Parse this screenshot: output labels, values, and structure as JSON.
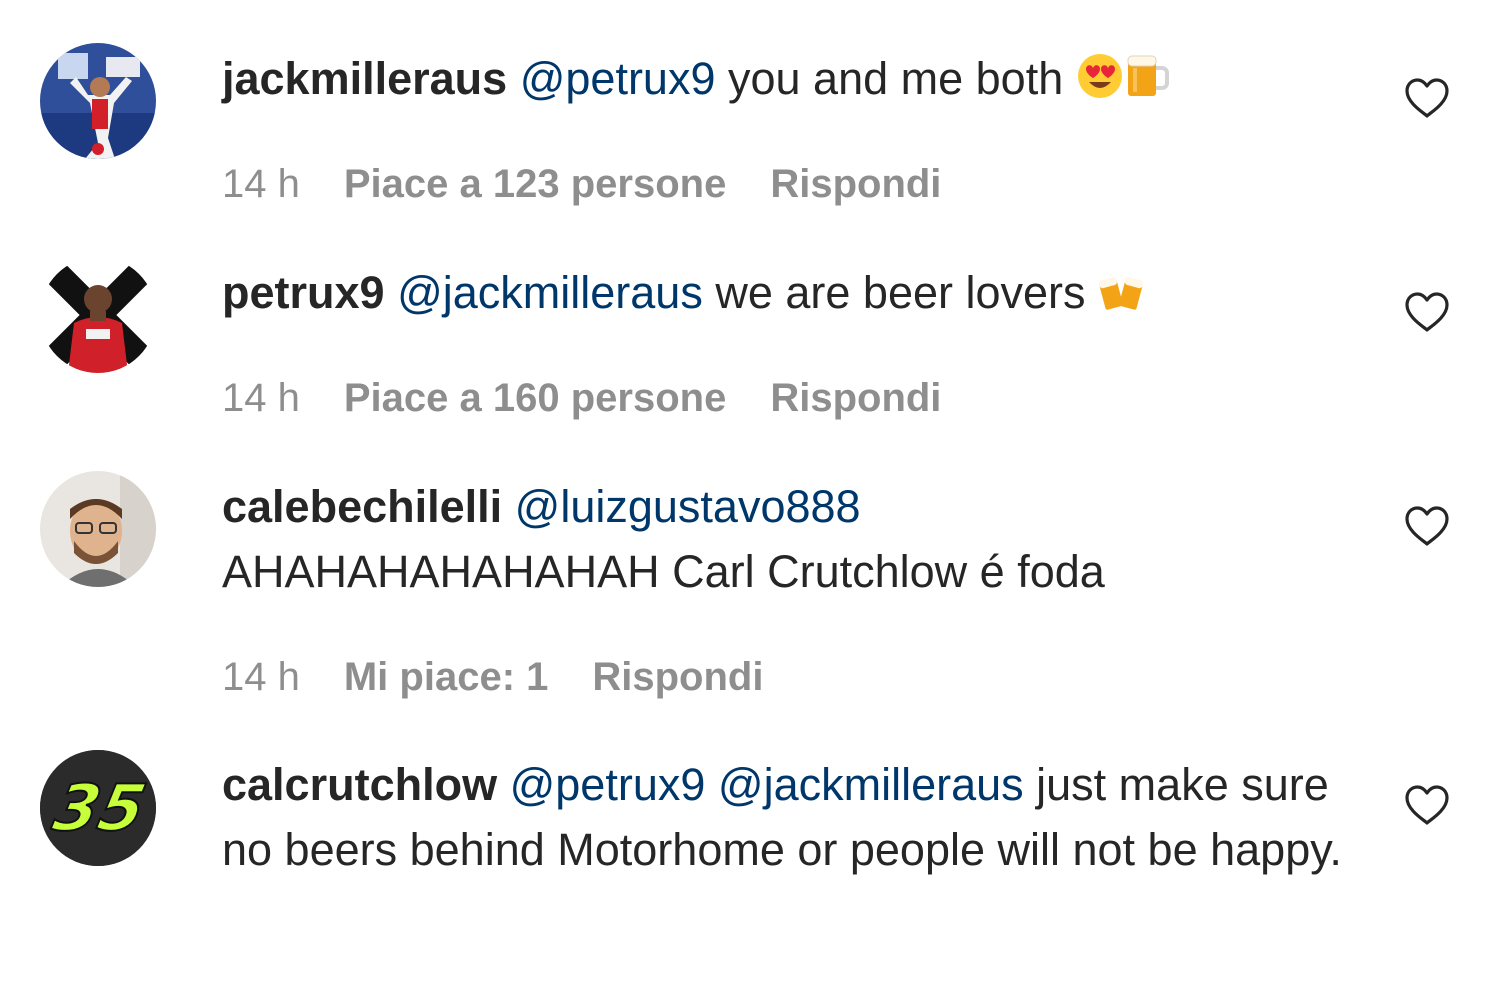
{
  "comments": [
    {
      "username": "jackmilleraus",
      "mentions": [
        "@petrux9"
      ],
      "text": "you and me both",
      "emojis": [
        "heart-eyes-emoji",
        "beer-mug-emoji"
      ],
      "time": "14 h",
      "likes": "Piace a 123 persone",
      "reply": "Rispondi"
    },
    {
      "username": "petrux9",
      "mentions": [
        "@jackmilleraus"
      ],
      "text": "we are beer lovers",
      "emojis": [
        "clinking-beers-emoji"
      ],
      "time": "14 h",
      "likes": "Piace a 160 persone",
      "reply": "Rispondi"
    },
    {
      "username": "calebechilelli",
      "mentions": [
        "@luizgustavo888"
      ],
      "text": "AHAHAHAHAHAHAH Carl Crutchlow é foda",
      "time": "14 h",
      "likes": "Mi piace: 1",
      "reply": "Rispondi"
    },
    {
      "username": "calcrutchlow",
      "mentions": [
        "@petrux9",
        "@jackmilleraus"
      ],
      "text": "just make sure no beers behind Motorhome or people will not be happy.",
      "avatar_number": "35"
    }
  ],
  "colors": {
    "text": "#262626",
    "mention": "#00376b",
    "meta": "#8e8e8e",
    "avatar4_bg": "#2b2b2b",
    "avatar4_number": "#c6ff3a"
  }
}
